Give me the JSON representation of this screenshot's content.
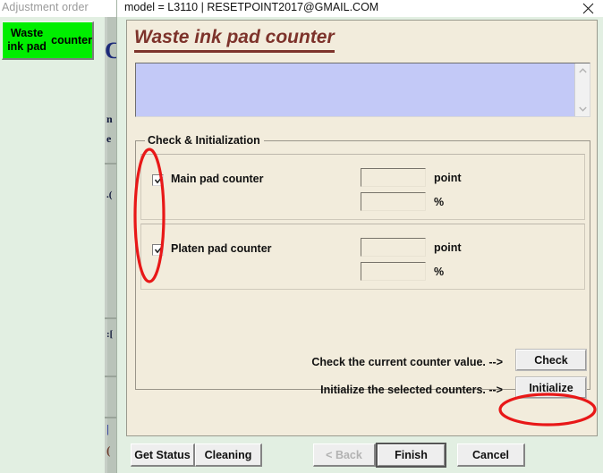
{
  "background_app": {
    "order_label": "Adjustment order",
    "selected_item": {
      "line1": "Waste ink pad",
      "line2": "counter",
      "color": "#00ee00"
    }
  },
  "window": {
    "title": "model = L3110 | RESETPOINT2017@GMAIL.COM",
    "close_label": "✕"
  },
  "page": {
    "title": "Waste ink pad counter",
    "title_color": "#7d332b",
    "message_box": {
      "value": "",
      "background": "#c3c9f7",
      "scroll_up": "⌃",
      "scroll_down": "⌄"
    },
    "group": {
      "legend": "Check & Initialization",
      "counters": [
        {
          "name": "main-pad-counter",
          "label": "Main pad counter",
          "checked": true,
          "point_value": "",
          "point_unit": "point",
          "percent_value": "",
          "percent_unit": "%"
        },
        {
          "name": "platen-pad-counter",
          "label": "Platen pad counter",
          "checked": true,
          "point_value": "",
          "point_unit": "point",
          "percent_value": "",
          "percent_unit": "%"
        }
      ]
    },
    "actions": [
      {
        "hint": "Check the current counter value. -->",
        "button": "Check"
      },
      {
        "hint": "Initialize the selected counters. -->",
        "button": "Initialize"
      }
    ]
  },
  "button_bar": {
    "get_status": "Get Status",
    "cleaning": "Cleaning",
    "back": "< Back",
    "finish": "Finish",
    "cancel": "Cancel"
  },
  "annotations": {
    "color": "#e81818",
    "items": [
      {
        "name": "checkbox-highlight-ellipse"
      },
      {
        "name": "initialize-button-highlight-ellipse"
      }
    ]
  }
}
